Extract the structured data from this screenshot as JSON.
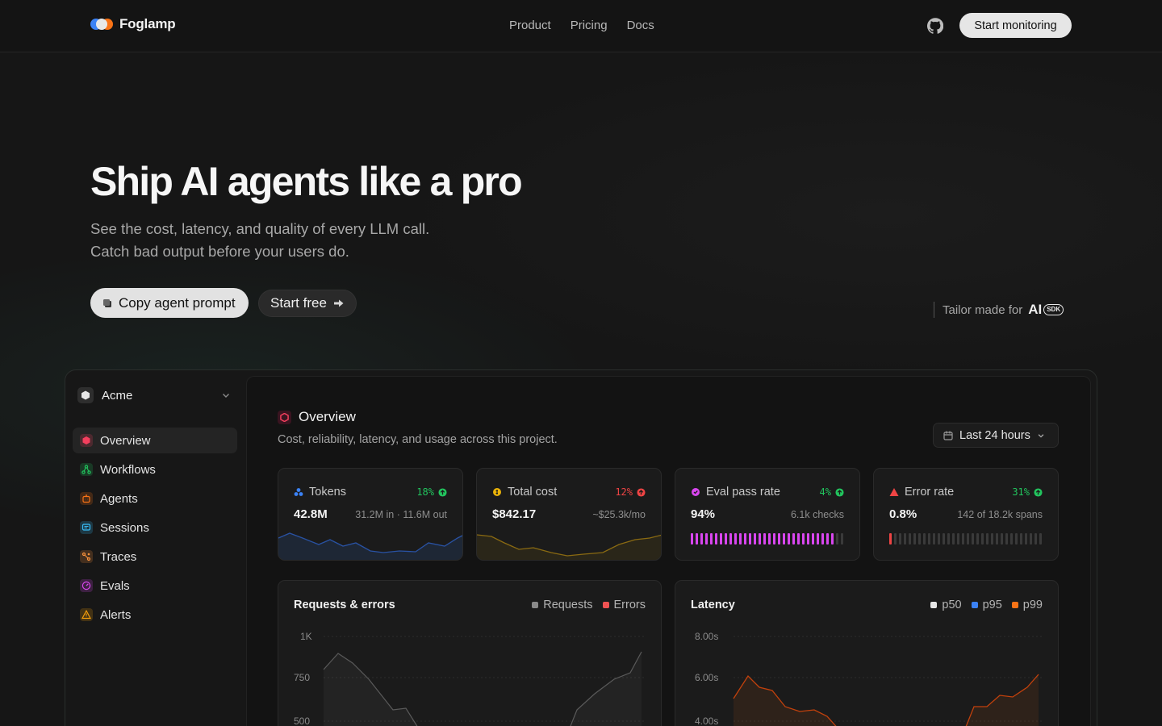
{
  "nav": {
    "brand": "Foglamp",
    "links": [
      "Product",
      "Pricing",
      "Docs"
    ],
    "cta": "Start monitoring"
  },
  "hero": {
    "title": "Ship AI agents like a pro",
    "subtitle_line1": "See the cost, latency, and quality of every LLM call.",
    "subtitle_line2": "Catch bad output before your users do.",
    "copy_button": "Copy agent prompt",
    "start_button": "Start free",
    "tailor_text": "Tailor made for",
    "ai_logo": "AI",
    "sdk_badge": "SDK"
  },
  "app": {
    "workspace": "Acme",
    "sidebar": [
      {
        "label": "Overview",
        "icon": "hexagon-icon",
        "color": "#f43f5e",
        "active": true
      },
      {
        "label": "Workflows",
        "icon": "workflow-icon",
        "color": "#22c55e",
        "active": false
      },
      {
        "label": "Agents",
        "icon": "bot-icon",
        "color": "#f97316",
        "active": false
      },
      {
        "label": "Sessions",
        "icon": "chat-icon",
        "color": "#38bdf8",
        "active": false
      },
      {
        "label": "Traces",
        "icon": "trace-icon",
        "color": "#fb923c",
        "active": false
      },
      {
        "label": "Evals",
        "icon": "gauge-icon",
        "color": "#d946ef",
        "active": false
      },
      {
        "label": "Alerts",
        "icon": "warning-icon",
        "color": "#f59e0b",
        "active": false
      }
    ],
    "overview": {
      "title": "Overview",
      "subtitle": "Cost, reliability, latency, and usage across this project.",
      "range": "Last 24 hours"
    },
    "stats": [
      {
        "name": "Tokens",
        "delta": "18%",
        "delta_color": "#22c55e",
        "value": "42.8M",
        "meta": "31.2M in · 11.6M out",
        "accent": "#3b82f6"
      },
      {
        "name": "Total cost",
        "delta": "12%",
        "delta_color": "#ef4444",
        "value": "$842.17",
        "meta": "~$25.3k/mo",
        "accent": "#eab308"
      },
      {
        "name": "Eval pass rate",
        "delta": "4%",
        "delta_color": "#22c55e",
        "value": "94%",
        "meta": "6.1k checks",
        "accent": "#d946ef",
        "fill": 0.94
      },
      {
        "name": "Error rate",
        "delta": "31%",
        "delta_color": "#22c55e",
        "value": "0.8%",
        "meta": "142 of 18.2k spans",
        "accent": "#ef4444",
        "fill": 0.03
      }
    ],
    "requests_chart": {
      "title": "Requests & errors",
      "legend": [
        {
          "name": "Requests",
          "color": "#8a8a8a"
        },
        {
          "name": "Errors",
          "color": "#f05252"
        }
      ],
      "y_ticks": [
        "1K",
        "750",
        "500"
      ]
    },
    "latency_chart": {
      "title": "Latency",
      "legend": [
        {
          "name": "p50",
          "color": "#e6e6e6"
        },
        {
          "name": "p95",
          "color": "#3b82f6"
        },
        {
          "name": "p99",
          "color": "#f97316"
        }
      ],
      "y_ticks": [
        "8.00s",
        "6.00s",
        "4.00s"
      ]
    }
  }
}
